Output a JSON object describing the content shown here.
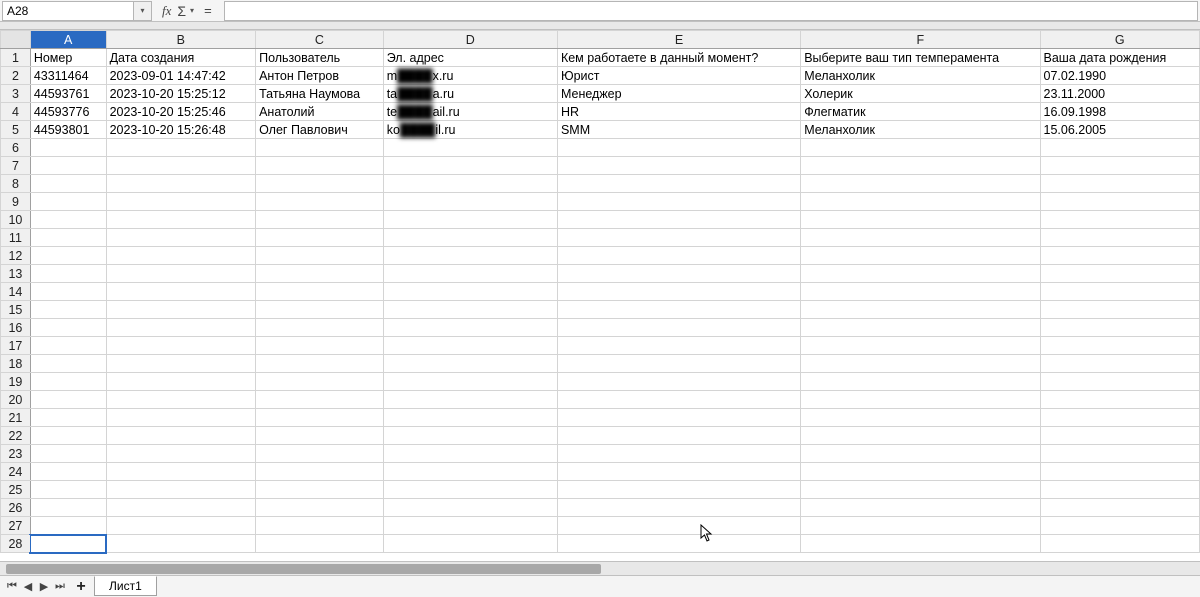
{
  "formula_bar": {
    "cell_ref": "A28",
    "fx_label": "fx",
    "sigma_label": "Σ",
    "eq_label": "=",
    "formula_value": ""
  },
  "columns": [
    "A",
    "B",
    "C",
    "D",
    "E",
    "F",
    "G"
  ],
  "selected_column": "A",
  "active_cell": "A28",
  "row_numbers": [
    1,
    2,
    3,
    4,
    5,
    6,
    7,
    8,
    9,
    10,
    11,
    12,
    13,
    14,
    15,
    16,
    17,
    18,
    19,
    20,
    21,
    22,
    23,
    24,
    25,
    26,
    27,
    28
  ],
  "headers": {
    "A": "Номер",
    "B": "Дата создания",
    "C": "Пользователь",
    "D": "Эл. адрес",
    "E": "Кем работаете в данный момент?",
    "F": "Выберите ваш тип темперамента",
    "G": "Ваша дата рождения"
  },
  "rows": [
    {
      "A": "43311464",
      "B": "2023-09-01 14:47:42",
      "C": "Антон Петров",
      "D_pre": "m",
      "D_blur": "████",
      "D_post": "x.ru",
      "E": "Юрист",
      "F": "Меланхолик",
      "G": "07.02.1990"
    },
    {
      "A": "44593761",
      "B": "2023-10-20 15:25:12",
      "C": "Татьяна Наумова",
      "D_pre": "ta",
      "D_blur": "████",
      "D_post": "a.ru",
      "E": "Менеджер",
      "F": "Холерик",
      "G": "23.11.2000"
    },
    {
      "A": "44593776",
      "B": "2023-10-20 15:25:46",
      "C": "Анатолий",
      "D_pre": "te",
      "D_blur": "████",
      "D_post": "ail.ru",
      "E": "HR",
      "F": "Флегматик",
      "G": "16.09.1998"
    },
    {
      "A": "44593801",
      "B": "2023-10-20 15:26:48",
      "C": "Олег Павлович",
      "D_pre": "ko",
      "D_blur": "████",
      "D_post": "il.ru",
      "E": "SMM",
      "F": "Меланхолик",
      "G": "15.06.2005"
    }
  ],
  "sheet_tabs": {
    "active": "Лист1"
  }
}
